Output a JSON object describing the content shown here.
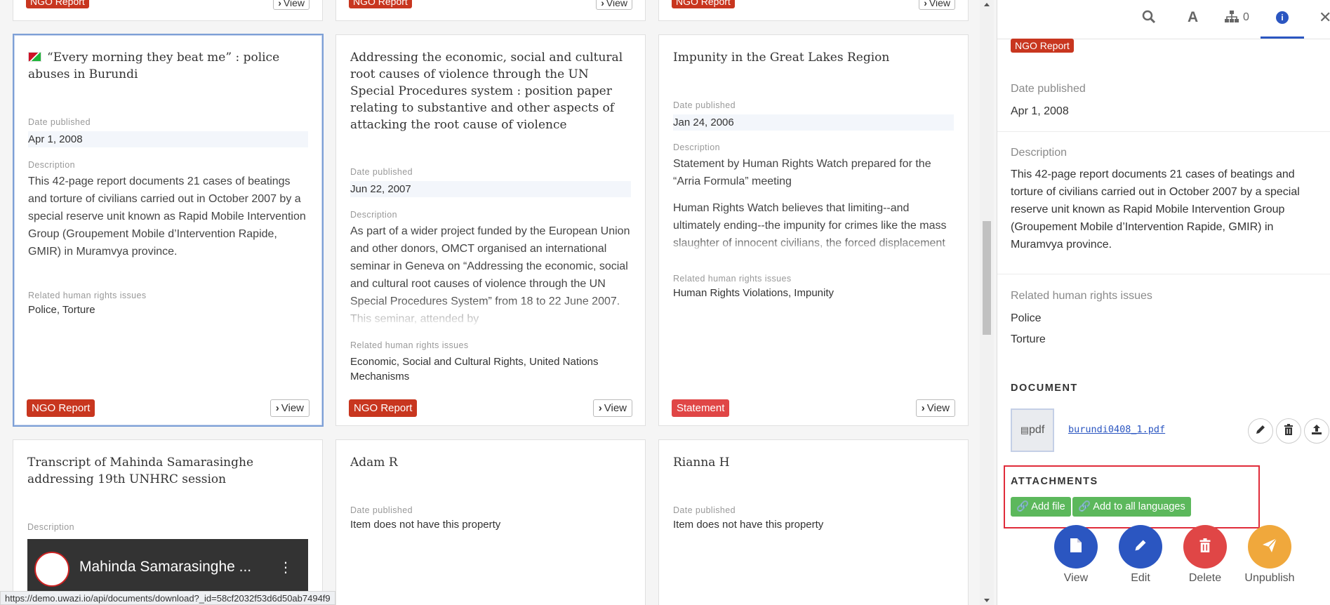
{
  "cards_top_row": [
    {
      "badge": "NGO Report",
      "view": "View"
    },
    {
      "badge": "NGO Report",
      "view": "View"
    },
    {
      "badge": "NGO Report",
      "view": "View"
    }
  ],
  "cards": [
    {
      "title": "“Every morning they beat me” : police abuses in Burundi",
      "date_label": "Date published",
      "date": "Apr 1, 2008",
      "desc_label": "Description",
      "description": "This 42-page report documents 21 cases of beatings and torture of civilians carried out in October 2007 by a special reserve unit known as Rapid Mobile Intervention Group (Groupement Mobile d’Intervention Rapide, GMIR) in Muramvya province.",
      "issues_label": "Related human rights issues",
      "issues": "Police, Torture",
      "badge": "NGO Report",
      "view": "View"
    },
    {
      "title": "Addressing the economic, social and cultural root causes of violence through the UN Special Procedures system : position paper relating to substantive and other aspects of attacking the root cause of violence",
      "date_label": "Date published",
      "date": "Jun 22, 2007",
      "desc_label": "Description",
      "description": "As part of a wider project funded by the European Union and other donors, OMCT organised an international seminar in Geneva on “Addressing the economic, social and cultural root causes of violence through the UN Special Procedures System” from 18 to 22 June 2007. This seminar, attended by",
      "issues_label": "Related human rights issues",
      "issues": "Economic, Social and Cultural Rights, United Nations Mechanisms",
      "badge": "NGO Report",
      "view": "View"
    },
    {
      "title": "Impunity in the Great Lakes Region",
      "date_label": "Date published",
      "date": "Jan 24, 2006",
      "desc_label": "Description",
      "description": "Statement by Human Rights Watch prepared for the “Arria Formula” meeting",
      "description2": "Human Rights Watch believes that limiting--and ultimately ending--the impunity for crimes like the mass slaughter of innocent civilians, the forced displacement of populations along ethnic lines and",
      "issues_label": "Related human rights issues",
      "issues": "Human Rights Violations, Impunity",
      "badge": "Statement",
      "view": "View"
    },
    {
      "title": "Transcript of Mahinda Samarasinghe addressing 19th UNHRC session",
      "desc_label": "Description",
      "video_title": "Mahinda Samarasinghe ..."
    },
    {
      "title": "Adam R",
      "date_label": "Date published",
      "date": "Item does not have this property"
    },
    {
      "title": "Rianna H",
      "date_label": "Date published",
      "date": "Item does not have this property"
    }
  ],
  "status_url": "https://demo.uwazi.io/api/documents/download?_id=58cf2032f53d6d50ab7494f9",
  "panel": {
    "toolbar": {
      "connections_count": "0"
    },
    "badge": "NGO Report",
    "date_label": "Date published",
    "date": "Apr 1, 2008",
    "desc_label": "Description",
    "description": "This 42-page report documents 21 cases of beatings and torture of civilians carried out in October 2007 by a special reserve unit known as Rapid Mobile Intervention Group (Groupement Mobile d’Intervention Rapide, GMIR) in Muramvya province.",
    "issues_label": "Related human rights issues",
    "issues": [
      "Police",
      "Torture"
    ],
    "document_heading": "DOCUMENT",
    "doc_type": "pdf",
    "doc_filename": "burundi0408_1.pdf",
    "attachments_heading": "ATTACHMENTS",
    "add_file": "Add file",
    "add_all_languages": "Add to all languages",
    "actions": {
      "view": "View",
      "edit": "Edit",
      "delete": "Delete",
      "unpublish": "Unpublish"
    }
  },
  "colors": {
    "accent": "#2b56c1",
    "ngo_badge": "#c8361f",
    "statement_badge": "#e04646",
    "green": "#5cb85c",
    "delete": "#e04646",
    "unpublish": "#f0a83c"
  }
}
